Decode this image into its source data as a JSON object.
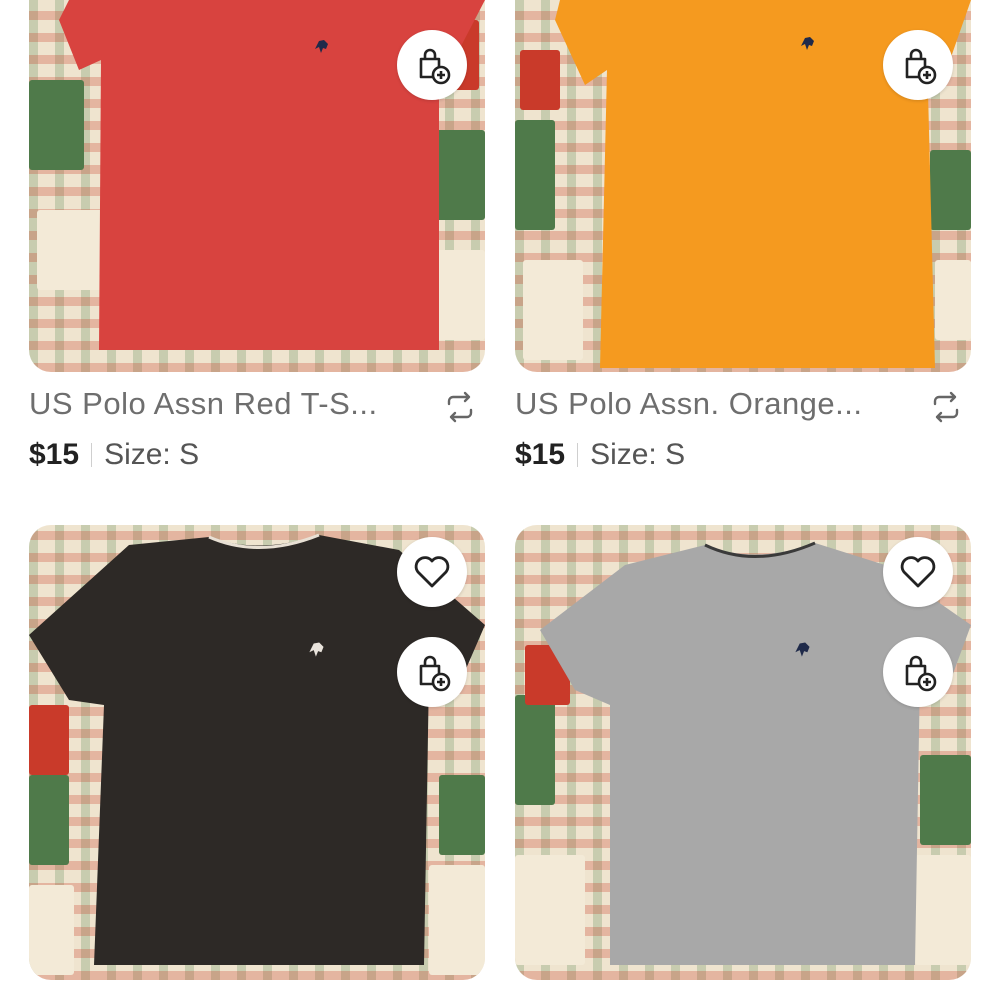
{
  "listings": [
    {
      "title": "US Polo Assn Red T-S...",
      "price": "$15",
      "size": "Size: S",
      "shirt_color": "#d8433f",
      "logo_color": "#1f2a4a",
      "buttons": [
        "bag-add-icon"
      ],
      "icons": {
        "bag": "bag-add-icon",
        "share": "repost-icon"
      }
    },
    {
      "title": "US Polo Assn. Orange...",
      "price": "$15",
      "size": "Size: S",
      "shirt_color": "#f59a1f",
      "logo_color": "#1f2a4a",
      "buttons": [
        "bag-add-icon"
      ],
      "icons": {
        "bag": "bag-add-icon",
        "share": "repost-icon"
      }
    },
    {
      "title": "",
      "price": "",
      "size": "",
      "shirt_color": "#2d2926",
      "logo_color": "#e9e3dc",
      "buttons": [
        "heart-icon",
        "bag-add-icon"
      ],
      "icons": {
        "heart": "heart-icon",
        "bag": "bag-add-icon"
      }
    },
    {
      "title": "",
      "price": "",
      "size": "",
      "shirt_color": "#a8a8a8",
      "logo_color": "#1f2a4a",
      "buttons": [
        "heart-icon",
        "bag-add-icon"
      ],
      "icons": {
        "heart": "heart-icon",
        "bag": "bag-add-icon"
      }
    }
  ]
}
